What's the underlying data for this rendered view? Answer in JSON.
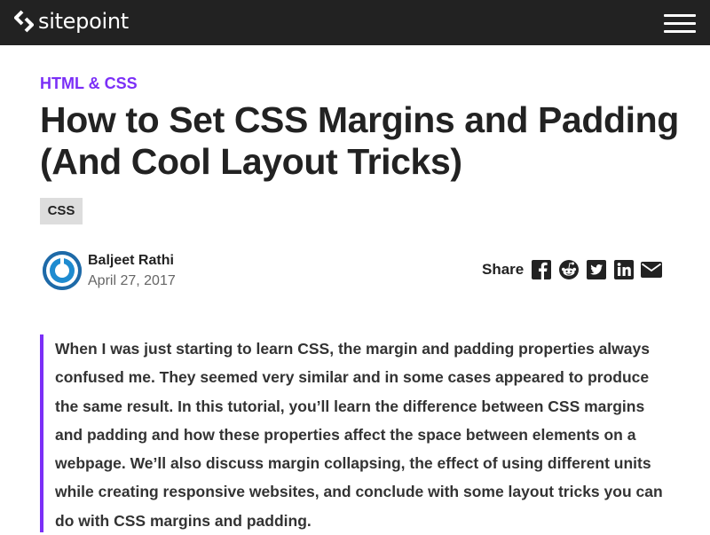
{
  "header": {
    "brand": "sitepoint",
    "logo_icon": "sitepoint-logo-icon",
    "menu_icon": "hamburger-menu-icon",
    "background": "#222222"
  },
  "article": {
    "category": "HTML & CSS",
    "title": "How to Set CSS Margins and Padding (And Cool Layout Tricks)",
    "tag": "CSS",
    "author": {
      "name": "Baljeet Rathi",
      "date": "April 27, 2017",
      "avatar_icon": "author-avatar"
    },
    "share": {
      "label": "Share",
      "icons": [
        "facebook-icon",
        "reddit-icon",
        "twitter-icon",
        "linkedin-icon",
        "email-icon"
      ]
    },
    "intro": "When I was just starting to learn CSS, the margin and padding properties always confused me. They seemed very similar and in some cases appeared to produce the same result. In this tutorial, you’ll learn the difference between CSS margins and padding and how these properties affect the space between elements on a webpage. We’ll also discuss margin collapsing, the effect of using different units while creating responsive websites, and conclude with some layout tricks you can do with CSS margins and padding."
  },
  "colors": {
    "accent": "#7b2ff7",
    "text": "#222222",
    "muted": "#666666",
    "tag_bg": "#dddddd"
  }
}
